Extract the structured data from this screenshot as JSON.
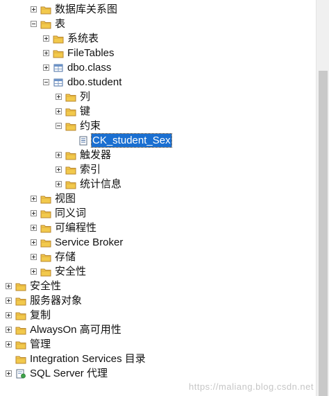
{
  "tree": [
    {
      "label": "数据库关系图",
      "icon": "folder-icon",
      "level": 3,
      "expander": "plus"
    },
    {
      "label": "表",
      "icon": "folder-icon",
      "level": 3,
      "expander": "minus"
    },
    {
      "label": "系统表",
      "icon": "folder-icon",
      "level": 4,
      "expander": "plus"
    },
    {
      "label": "FileTables",
      "icon": "folder-icon",
      "level": 4,
      "expander": "plus"
    },
    {
      "label": "dbo.class",
      "icon": "table-icon",
      "level": 4,
      "expander": "plus"
    },
    {
      "label": "dbo.student",
      "icon": "table-icon",
      "level": 4,
      "expander": "minus"
    },
    {
      "label": "列",
      "icon": "folder-icon",
      "level": 5,
      "expander": "plus"
    },
    {
      "label": "键",
      "icon": "folder-icon",
      "level": 5,
      "expander": "plus"
    },
    {
      "label": "约束",
      "icon": "folder-icon",
      "level": 5,
      "expander": "minus"
    },
    {
      "label": "CK_student_Sex",
      "icon": "constraint-icon",
      "level": 6,
      "expander": "none",
      "selected": true
    },
    {
      "label": "触发器",
      "icon": "folder-icon",
      "level": 5,
      "expander": "plus"
    },
    {
      "label": "索引",
      "icon": "folder-icon",
      "level": 5,
      "expander": "plus"
    },
    {
      "label": "统计信息",
      "icon": "folder-icon",
      "level": 5,
      "expander": "plus"
    },
    {
      "label": "视图",
      "icon": "folder-icon",
      "level": 3,
      "expander": "plus"
    },
    {
      "label": "同义词",
      "icon": "folder-icon",
      "level": 3,
      "expander": "plus"
    },
    {
      "label": "可编程性",
      "icon": "folder-icon",
      "level": 3,
      "expander": "plus"
    },
    {
      "label": "Service Broker",
      "icon": "folder-icon",
      "level": 3,
      "expander": "plus"
    },
    {
      "label": "存储",
      "icon": "folder-icon",
      "level": 3,
      "expander": "plus"
    },
    {
      "label": "安全性",
      "icon": "folder-icon",
      "level": 3,
      "expander": "plus"
    },
    {
      "label": "安全性",
      "icon": "folder-icon",
      "level": 1,
      "expander": "plus"
    },
    {
      "label": "服务器对象",
      "icon": "folder-icon",
      "level": 1,
      "expander": "plus"
    },
    {
      "label": "复制",
      "icon": "folder-icon",
      "level": 1,
      "expander": "plus"
    },
    {
      "label": "AlwaysOn 高可用性",
      "icon": "folder-icon",
      "level": 1,
      "expander": "plus"
    },
    {
      "label": "管理",
      "icon": "folder-icon",
      "level": 1,
      "expander": "plus"
    },
    {
      "label": "Integration Services 目录",
      "icon": "folder-icon",
      "level": 1,
      "expander": "none"
    },
    {
      "label": "SQL Server 代理",
      "icon": "agent-icon",
      "level": 1,
      "expander": "plus"
    }
  ],
  "watermark": "https://maliang.blog.csdn.net",
  "colors": {
    "folder_fill": "#f2c94c",
    "folder_stroke": "#b8862e",
    "selection": "#1a6fd1",
    "scroll_track": "#f0f0f0",
    "scroll_thumb": "#c9c9c9"
  }
}
